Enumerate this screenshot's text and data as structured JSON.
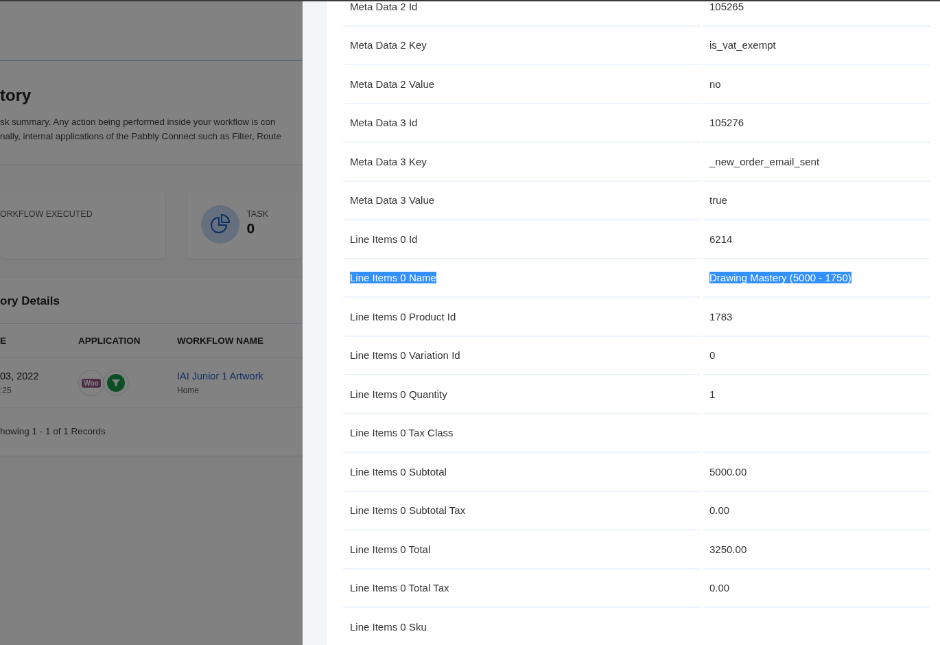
{
  "background_page": {
    "header": {
      "title": "tory",
      "description": [
        "sk summary. Any action being performed inside your workflow is con",
        "nally, internal applications of the Pabbly Connect such as Filter, Route"
      ]
    },
    "stats": [
      {
        "kind": "plain",
        "label": "ORKFLOW EXECUTED"
      },
      {
        "kind": "icon",
        "label": "TASK",
        "value": "0"
      }
    ],
    "details": {
      "title": "ory Details",
      "columns": [
        "E",
        "APPLICATION",
        "WORKFLOW NAME"
      ],
      "rows": [
        {
          "date": "03, 2022",
          "time": ":25",
          "apps": [
            {
              "kind": "logo",
              "label": "Woo"
            },
            {
              "kind": "filter"
            }
          ],
          "workflow": "IAI Junior 1 Artwork",
          "folder": "Home"
        }
      ],
      "footer": "howing 1 - 1 of 1 Records"
    }
  },
  "drawer": {
    "rows": [
      {
        "key": "Meta Data 2 Id",
        "value": "105265",
        "highlighted": false
      },
      {
        "key": "Meta Data 2 Key",
        "value": "is_vat_exempt",
        "highlighted": false
      },
      {
        "key": "Meta Data 2 Value",
        "value": "no",
        "highlighted": false
      },
      {
        "key": "Meta Data 3 Id",
        "value": "105276",
        "highlighted": false
      },
      {
        "key": "Meta Data 3 Key",
        "value": "_new_order_email_sent",
        "highlighted": false
      },
      {
        "key": "Meta Data 3 Value",
        "value": "true",
        "highlighted": false
      },
      {
        "key": "Line Items 0 Id",
        "value": "6214",
        "highlighted": false
      },
      {
        "key": "Line Items 0 Name",
        "value": "Drawing Mastery (5000 - 1750)",
        "highlighted": true
      },
      {
        "key": "Line Items 0 Product Id",
        "value": "1783",
        "highlighted": false
      },
      {
        "key": "Line Items 0 Variation Id",
        "value": "0",
        "highlighted": false
      },
      {
        "key": "Line Items 0 Quantity",
        "value": "1",
        "highlighted": false
      },
      {
        "key": "Line Items 0 Tax Class",
        "highlighted": false
      },
      {
        "key": "Line Items 0 Subtotal",
        "value": "5000.00",
        "highlighted": false
      },
      {
        "key": "Line Items 0 Subtotal Tax",
        "value": "0.00",
        "highlighted": false
      },
      {
        "key": "Line Items 0 Total",
        "value": "3250.00",
        "highlighted": false
      },
      {
        "key": "Line Items 0 Total Tax",
        "value": "0.00",
        "highlighted": false
      },
      {
        "key": "Line Items 0 Sku",
        "highlighted": false
      }
    ]
  }
}
